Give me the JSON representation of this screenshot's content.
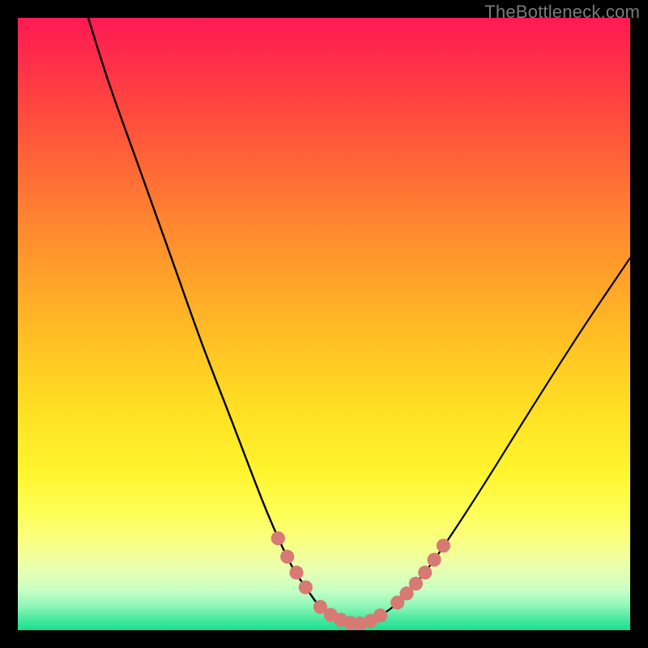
{
  "watermark": "TheBottleneck.com",
  "colors": {
    "frame": "#000000",
    "curve": "#000000",
    "marker_fill": "#d77a74",
    "marker_stroke": "#b85b58"
  },
  "chart_data": {
    "type": "line",
    "title": "",
    "xlabel": "",
    "ylabel": "",
    "xlim": [
      0,
      100
    ],
    "ylim": [
      0,
      100
    ],
    "grid": false,
    "series": [
      {
        "name": "left-branch",
        "x": [
          11.5,
          15,
          20,
          25,
          30,
          35,
          40,
          43,
          45,
          47,
          49,
          50,
          51,
          52,
          53.5,
          55
        ],
        "y": [
          100,
          89,
          75,
          61,
          47,
          34,
          21,
          14,
          10,
          7,
          4.2,
          3.2,
          2.4,
          1.8,
          1.2,
          1.0
        ]
      },
      {
        "name": "right-branch",
        "x": [
          55,
          57,
          59,
          61,
          63,
          65,
          68,
          72,
          76,
          80,
          84,
          88,
          92,
          96,
          100
        ],
        "y": [
          1.0,
          1.4,
          2.3,
          3.6,
          5.4,
          7.6,
          11.5,
          17.4,
          23.6,
          30.0,
          36.4,
          42.7,
          48.9,
          54.9,
          60.8
        ]
      }
    ],
    "markers": {
      "name": "highlight-points",
      "x": [
        42.5,
        44.0,
        45.5,
        47.0,
        49.4,
        51.1,
        52.7,
        54.3,
        55.9,
        57.6,
        59.2,
        62.0,
        63.5,
        65.0,
        66.5,
        68.0,
        69.5
      ],
      "y": [
        15.0,
        12.0,
        9.4,
        7.0,
        3.8,
        2.5,
        1.7,
        1.2,
        1.1,
        1.5,
        2.4,
        4.5,
        6.0,
        7.6,
        9.4,
        11.5,
        13.8
      ]
    }
  }
}
